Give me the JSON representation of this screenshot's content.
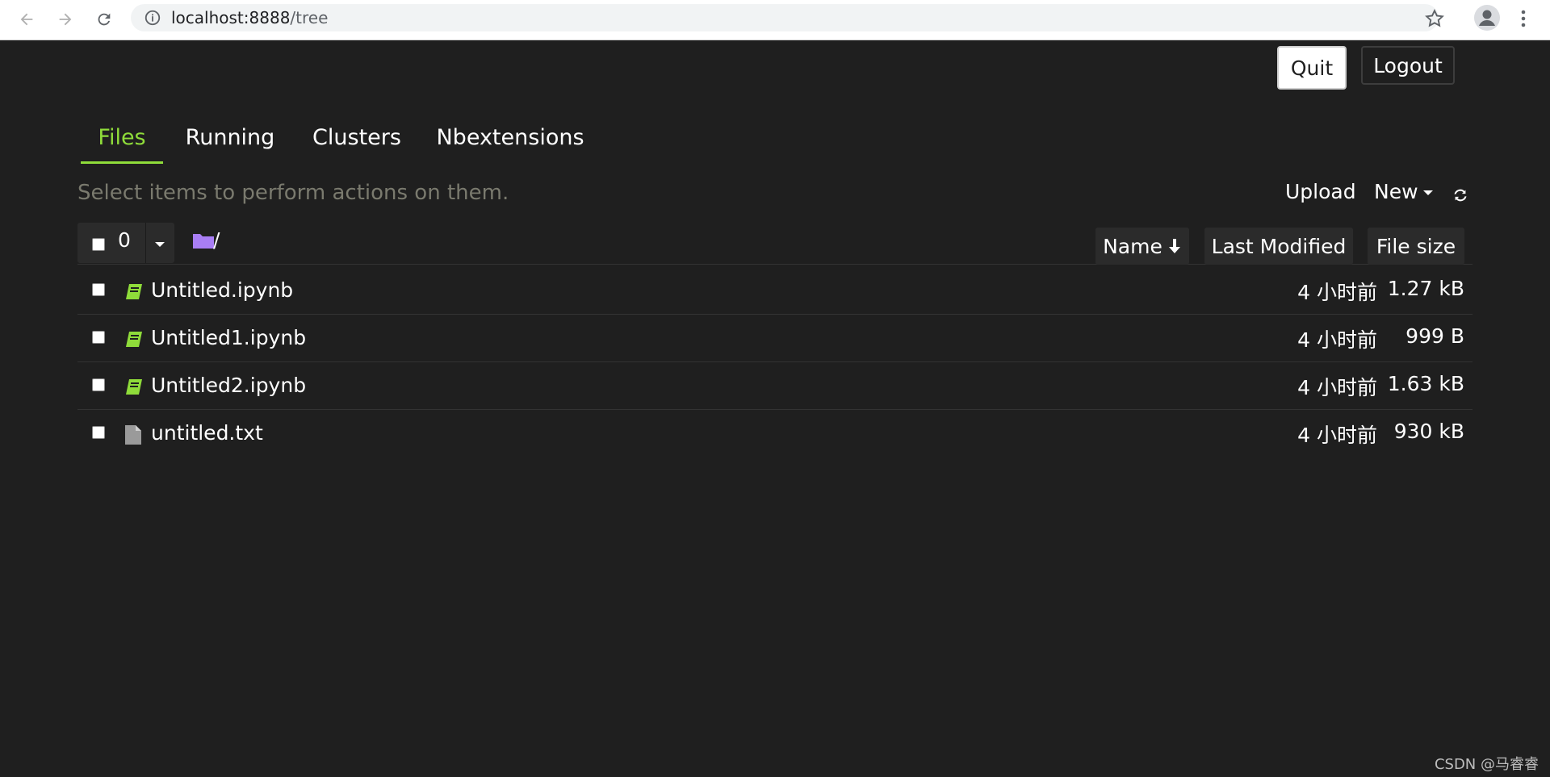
{
  "browser": {
    "url_host": "localhost:8888",
    "url_path": "/tree"
  },
  "header": {
    "quit_label": "Quit",
    "logout_label": "Logout"
  },
  "tabs": [
    {
      "label": "Files",
      "active": true
    },
    {
      "label": "Running",
      "active": false
    },
    {
      "label": "Clusters",
      "active": false
    },
    {
      "label": "Nbextensions",
      "active": false
    }
  ],
  "toolbar": {
    "hint": "Select items to perform actions on them.",
    "upload_label": "Upload",
    "new_label": "New",
    "refresh_icon": "refresh-icon"
  },
  "list": {
    "selected_count": "0",
    "path": "/",
    "columns": {
      "name": "Name",
      "last_modified": "Last Modified",
      "file_size": "File size"
    },
    "items": [
      {
        "name": "Untitled.ipynb",
        "type": "notebook",
        "modified": "4 小时前",
        "size": "1.27 kB"
      },
      {
        "name": "Untitled1.ipynb",
        "type": "notebook",
        "modified": "4 小时前",
        "size": "999 B"
      },
      {
        "name": "Untitled2.ipynb",
        "type": "notebook",
        "modified": "4 小时前",
        "size": "1.63 kB"
      },
      {
        "name": "untitled.txt",
        "type": "file",
        "modified": "4 小时前",
        "size": "930 kB"
      }
    ]
  },
  "colors": {
    "accent": "#8fdc3a",
    "background": "#1f1f1f",
    "folder": "#a97ef5"
  },
  "watermark": "CSDN @马睿睿"
}
